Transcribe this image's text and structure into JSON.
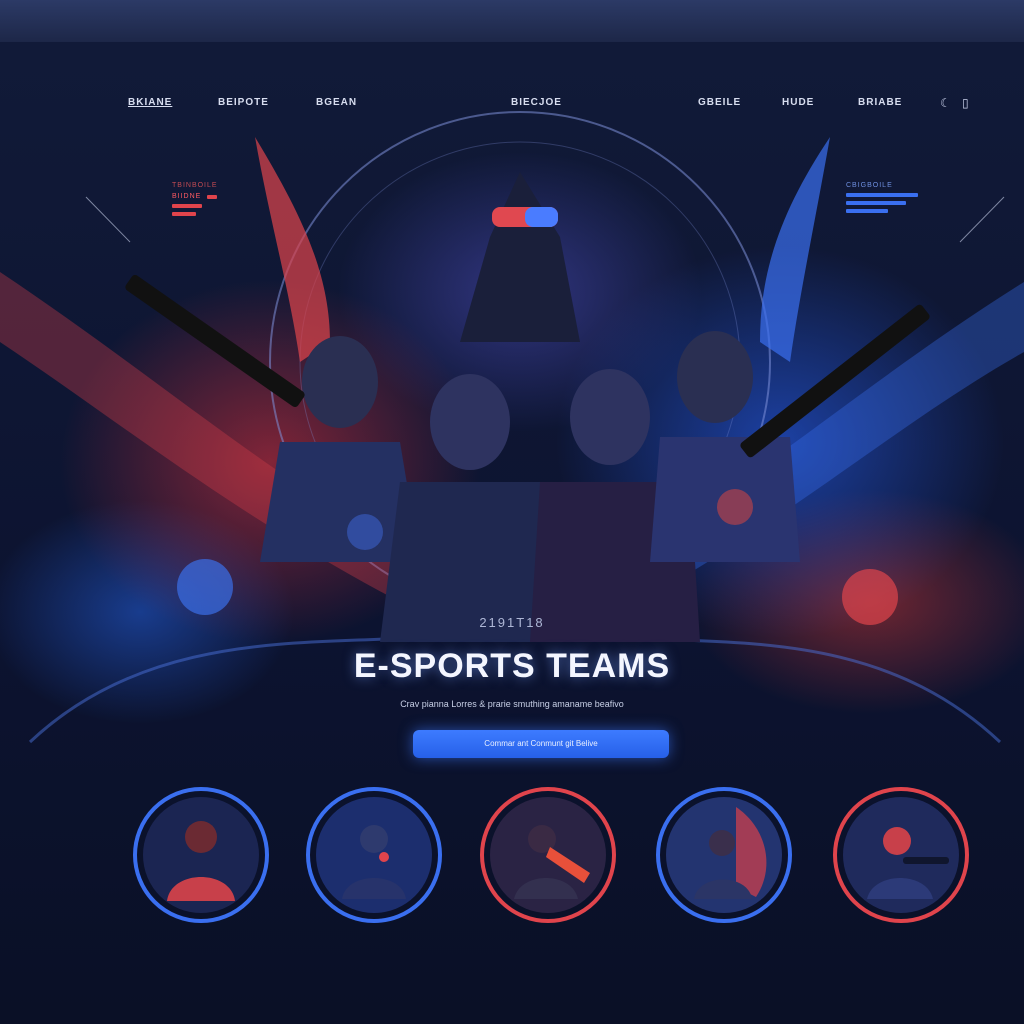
{
  "nav": {
    "items": [
      {
        "label": "BKIANE",
        "active": true
      },
      {
        "label": "BEIPOTE",
        "active": false
      },
      {
        "label": "BGEAN",
        "active": false
      },
      {
        "label": "BIECJOE",
        "active": false
      },
      {
        "label": "GBEILE",
        "active": false
      },
      {
        "label": "HUDE",
        "active": false
      },
      {
        "label": "BRIABE",
        "active": false
      }
    ],
    "icons": [
      "moon-icon",
      "menu-icon"
    ]
  },
  "panel_left": {
    "label_top": "TBINBOILE",
    "label_small": "BIIDNE"
  },
  "panel_right": {
    "label_top": "CBIGBOILE"
  },
  "hero": {
    "caption": "2191T18",
    "title": "E-SPORTS TEAMS",
    "subtitle": "Crav pianna Lorres & prarie smuthing amaname beafivo",
    "cta_label": "Commar ant Conmunt git Belive"
  },
  "team_avatars": [
    {
      "name": "player-1",
      "ring_color": "#3a6ff0"
    },
    {
      "name": "player-2",
      "ring_color": "#3a6ff0"
    },
    {
      "name": "player-3",
      "ring_color": "#e0444c"
    },
    {
      "name": "player-4",
      "ring_color": "#3a6ff0"
    },
    {
      "name": "player-5",
      "ring_color": "#e0444c"
    }
  ],
  "colors": {
    "accent_red": "#e0444c",
    "accent_blue": "#3a6ff0",
    "background": "#0b1124"
  }
}
